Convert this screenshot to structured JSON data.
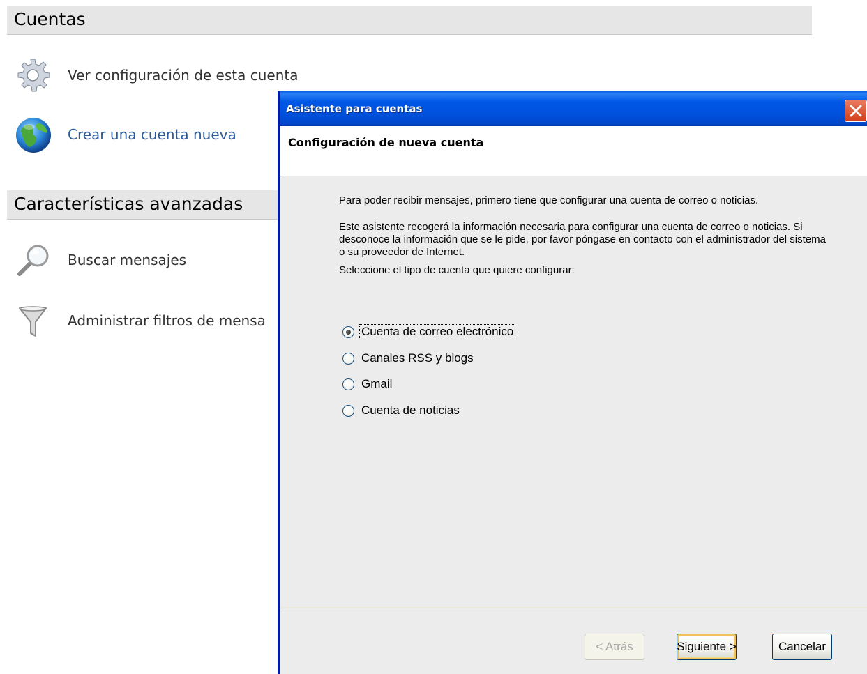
{
  "background": {
    "section1": {
      "title": "Cuentas"
    },
    "items1": [
      {
        "label": "Ver configuración de esta cuenta",
        "icon": "gear-icon"
      },
      {
        "label": "Crear una cuenta nueva",
        "icon": "globe-icon"
      }
    ],
    "section2": {
      "title": "Características avanzadas"
    },
    "items2": [
      {
        "label": "Buscar mensajes",
        "icon": "magnifier-icon"
      },
      {
        "label": "Administrar filtros de mensa",
        "icon": "funnel-icon"
      }
    ]
  },
  "dialog": {
    "window_title": "Asistente para cuentas",
    "close_icon": "close-icon",
    "header_title": "Configuración de nueva cuenta",
    "paragraph1": "Para poder recibir mensajes, primero tiene que configurar una cuenta de correo o noticias.",
    "paragraph2": "Este asistente recogerá la información necesaria para configurar una cuenta de correo o noticias. Si desconoce la información que se le pide, por favor póngase en contacto con el administrador del sistema o su proveedor de Internet.",
    "paragraph3": "Seleccione el tipo de cuenta que quiere configurar:",
    "options": [
      {
        "label": "Cuenta de correo electrónico",
        "checked": true
      },
      {
        "label": "Canales RSS y blogs",
        "checked": false
      },
      {
        "label": "Gmail",
        "checked": false
      },
      {
        "label": "Cuenta de noticias",
        "checked": false
      }
    ],
    "buttons": {
      "back": "< Atrás",
      "next": "Siguiente >",
      "cancel": "Cancelar"
    }
  },
  "colors": {
    "titlebar": "#0054e3",
    "link": "#2b5a9a",
    "close_button": "#d2401c"
  }
}
